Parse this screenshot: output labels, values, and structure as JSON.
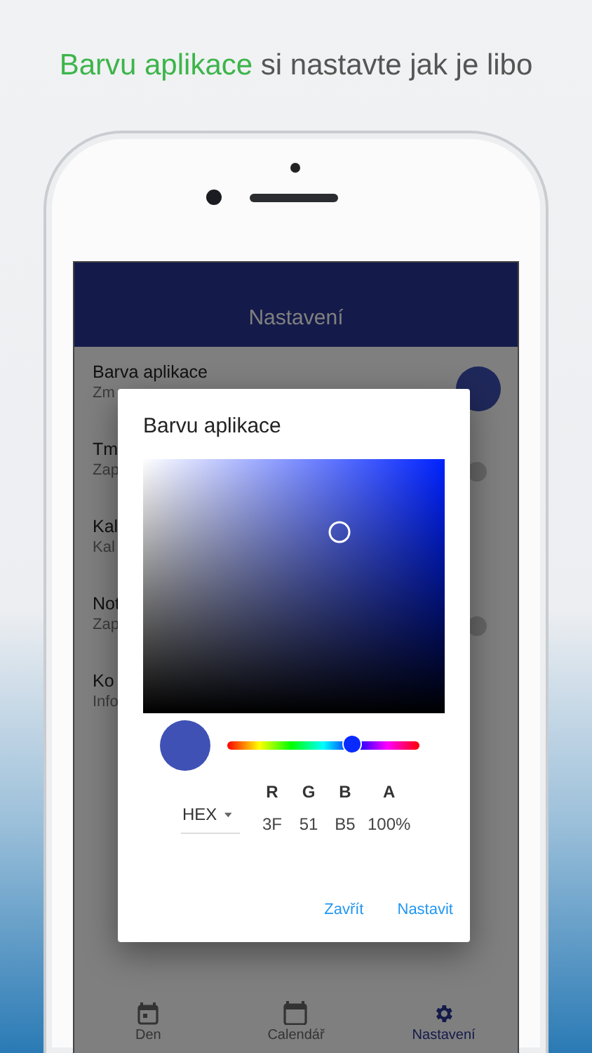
{
  "headline": [
    {
      "text": "Barvu aplikace",
      "kind": "accent"
    },
    {
      "text": " si nastavte jak je libo",
      "kind": "plain"
    }
  ],
  "app_bar": {
    "title": "Nastavení"
  },
  "settings": [
    {
      "title": "Barva aplikace",
      "subtitle": "Zm",
      "kind": "color"
    },
    {
      "title": "Tm",
      "subtitle": "Zap",
      "kind": "switch"
    },
    {
      "title": "Kal",
      "subtitle": "Kal",
      "kind": "plain"
    },
    {
      "title": "Not",
      "subtitle": "Zap",
      "kind": "switch"
    },
    {
      "title": "Ko",
      "subtitle": "Info",
      "kind": "plain"
    }
  ],
  "dialog": {
    "title": "Barvu aplikace",
    "hue": {
      "level": 0.65
    },
    "format": "HEX",
    "channels": [
      {
        "label": "R",
        "value": "3F"
      },
      {
        "label": "G",
        "value": "51"
      },
      {
        "label": "B",
        "value": "B5"
      },
      {
        "label": "A",
        "value": "100%"
      }
    ],
    "buttons": [
      "Zavřít",
      "Nastavit"
    ]
  },
  "bottom_nav": [
    {
      "label": "Den",
      "kind": "day",
      "selected": false
    },
    {
      "label": "Calendář",
      "kind": "calendar",
      "selected": false
    },
    {
      "label": "Nastavení",
      "kind": "settings",
      "selected": true
    }
  ]
}
